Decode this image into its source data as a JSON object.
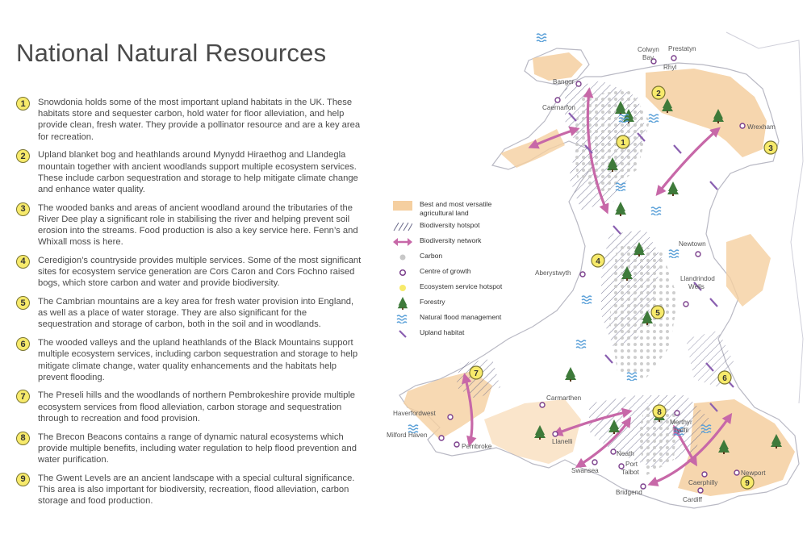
{
  "title": "National Natural Resources",
  "items": [
    {
      "number": "1",
      "text": "Snowdonia holds some of the most important upland habitats in the UK. These habitats store and sequester carbon, hold water for floor alleviation, and help provide clean, fresh water. They provide a pollinator resource and are a key area for recreation."
    },
    {
      "number": "2",
      "text": "Upland blanket bog and heathlands around Mynydd Hiraethog and Llandegla mountain together with ancient woodlands support multiple ecosystem services. These include carbon sequestration and storage to help mitigate climate change and enhance water quality."
    },
    {
      "number": "3",
      "text": "The wooded banks and areas of ancient woodland around the tributaries of the River Dee play a significant role in stabilising the river and helping prevent soil erosion into the streams. Food production is also a key service here. Fenn’s and Whixall moss is here."
    },
    {
      "number": "4",
      "text": "Ceredigion’s countryside provides multiple services. Some of the most significant sites for ecosystem service generation are Cors Caron and Cors Fochno raised bogs, which store carbon and water and provide biodiversity."
    },
    {
      "number": "5",
      "text": "The Cambrian mountains are a key area for fresh water provision into England, as well as a place of water storage. They are also significant for the sequestration and storage of carbon, both in the soil and in woodlands."
    },
    {
      "number": "6",
      "text": "The wooded valleys and the upland heathlands of the Black Mountains support multiple ecosystem services, including carbon sequestration and storage to help mitigate climate change, water quality enhancements and the habitats help prevent flooding."
    },
    {
      "number": "7",
      "text": "The Preseli hills and the woodlands of northern Pembrokeshire provide multiple ecosystem services from flood alleviation, carbon storage and sequestration through to recreation and food provision."
    },
    {
      "number": "8",
      "text": "The Brecon Beacons contains a range of dynamic natural ecosystems which provide multiple benefits, including water regulation to help flood prevention and water purification."
    },
    {
      "number": "9",
      "text": "The Gwent Levels are an ancient landscape with a special cultural significance. This area is also important for biodiversity, recreation, flood alleviation, carbon storage and food production."
    }
  ],
  "legend": [
    {
      "icon": "agricultural-land-swatch",
      "label": "Best and most versatile agricultural land",
      "color": "#f5cfa0"
    },
    {
      "icon": "biodiversity-hatch",
      "label": "Biodiversity hotspot",
      "color": "#6a6a8a"
    },
    {
      "icon": "double-arrow",
      "label": "Biodiversity network",
      "color": "#c768a8"
    },
    {
      "icon": "grey-dot",
      "label": "Carbon",
      "color": "#c8c8c8"
    },
    {
      "icon": "purple-ring",
      "label": "Centre of growth",
      "color": "#7b3f8c"
    },
    {
      "icon": "yellow-dot",
      "label": "Ecosystem service hotspot",
      "color": "#f7ea6b"
    },
    {
      "icon": "tree-icon",
      "label": "Forestry",
      "color": "#3e7a3a"
    },
    {
      "icon": "waves-icon",
      "label": "Natural flood management",
      "color": "#5aa0d8"
    },
    {
      "icon": "upland-dash",
      "label": "Upland habitat",
      "color": "#8a5fb0"
    }
  ],
  "places": [
    {
      "name": "Colwyn"
    },
    {
      "name": "Bay"
    },
    {
      "name": "Prestatyn"
    },
    {
      "name": "Rhyl"
    },
    {
      "name": "Bangor"
    },
    {
      "name": "Caernarfon"
    },
    {
      "name": "Wrexham"
    },
    {
      "name": "Newtown"
    },
    {
      "name": "Aberystwyth"
    },
    {
      "name": "Llandrindod"
    },
    {
      "name": "Wells"
    },
    {
      "name": "Carmarthen"
    },
    {
      "name": "Haverfordwest"
    },
    {
      "name": "Milford Haven"
    },
    {
      "name": "Pembroke"
    },
    {
      "name": "Llanelli"
    },
    {
      "name": "Swansea"
    },
    {
      "name": "Neath"
    },
    {
      "name": "Port"
    },
    {
      "name": "Talbot"
    },
    {
      "name": "Merthyr"
    },
    {
      "name": "Tydfil"
    },
    {
      "name": "Caerphilly"
    },
    {
      "name": "Newport"
    },
    {
      "name": "Bridgend"
    },
    {
      "name": "Cardiff"
    }
  ],
  "hotspots": [
    "1",
    "2",
    "3",
    "4",
    "5",
    "6",
    "7",
    "8",
    "9"
  ],
  "colors": {
    "agriculture": "#f5cfa0",
    "arrow": "#c768a8",
    "ring": "#7b3f8c",
    "hotspot": "#f7ea6b",
    "tree": "#3e7a3a",
    "water": "#5aa0d8",
    "upland": "#8a5fb0",
    "carbon": "#c8c8c8",
    "outline": "#b9b9c4"
  }
}
